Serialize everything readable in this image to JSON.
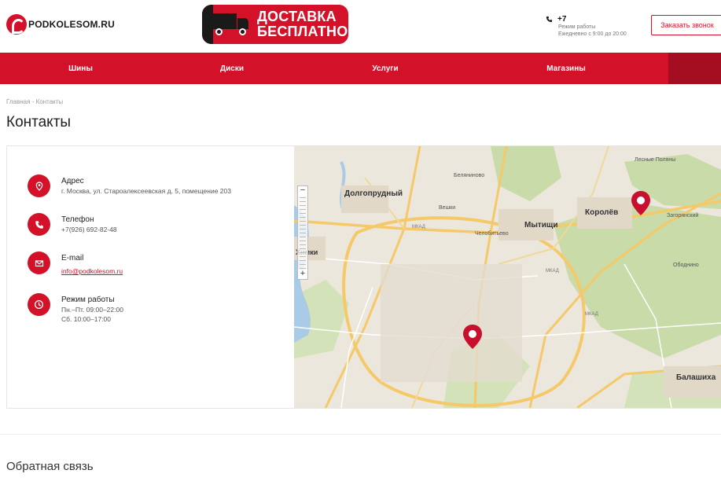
{
  "header": {
    "logo_text": "PODKOLESOM.RU",
    "promo_line1": "ДОСТАВКА",
    "promo_line2": "БЕСПЛАТНО",
    "phone": "+7",
    "hours_label": "Режим работы",
    "hours_value": "Ежедневно с 9:00 до 20:00",
    "callback_label": "Заказать звонок"
  },
  "nav": {
    "items": [
      {
        "label": "Шины"
      },
      {
        "label": "Диски"
      },
      {
        "label": "Услуги"
      },
      {
        "label": "Магазины"
      }
    ]
  },
  "breadcrumb": {
    "home": "Главная",
    "separator": "-",
    "current": "Контакты"
  },
  "page_title": "Контакты",
  "contacts": {
    "address_label": "Адрес",
    "address_value": "г. Москва, ул. Староалексеевская д. 5, помещение 203",
    "phone_label": "Телефон",
    "phone_value": "+7(926) 692-82-48",
    "email_label": "E-mail",
    "email_value": "info@podkolesom.ru",
    "hours_label": "Режим работы",
    "hours_weekdays": "Пн.–Пт. 09:00–22:00",
    "hours_saturday": "Сб. 10:00–17:00"
  },
  "map": {
    "labels": {
      "dolgoprudny": "Долгопрудный",
      "mytishchi": "Мытищи",
      "korolev": "Королёв",
      "khimki": "Химки",
      "balashikha": "Балашиха",
      "vodniki": "Беляниново",
      "veshki": "Вешки",
      "chelobitievo": "Челобитьево",
      "obolonino": "Ободнино",
      "zagoryansky": "Загорянский",
      "lesnye_polyany": "Лесные Поляны",
      "mkad1": "МКАД",
      "mkad2": "МКАД",
      "mkad3": "МКАД"
    },
    "colors": {
      "land": "#ece7dc",
      "forest": "#c8dba8",
      "water": "#a9cbe6",
      "road": "#f5c96a",
      "marker": "#c8102e"
    }
  },
  "colors": {
    "brand": "#d3122a"
  },
  "feedback_title": "Обратная связь"
}
